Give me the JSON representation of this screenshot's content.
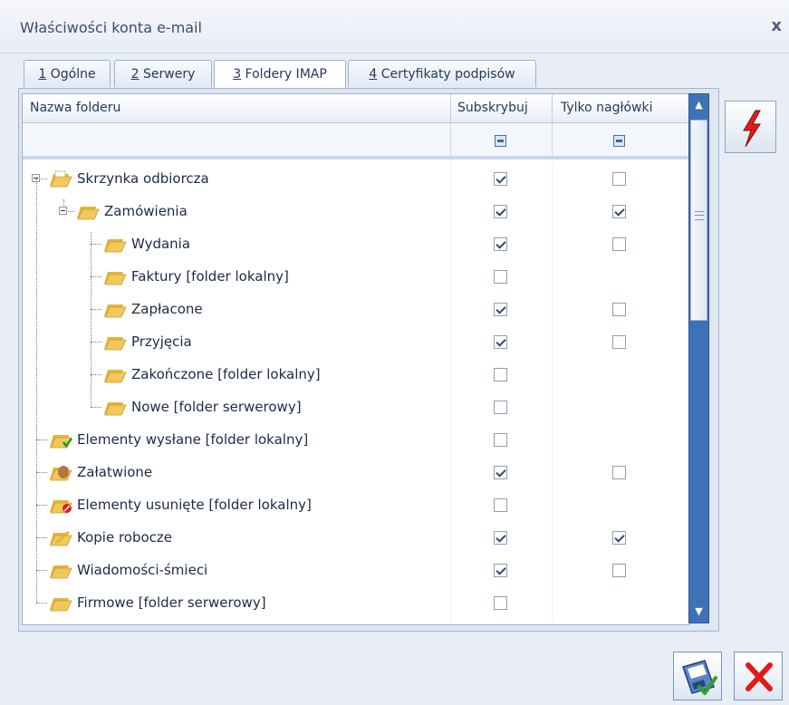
{
  "window": {
    "title": "Właściwości konta e-mail",
    "close_glyph": "x"
  },
  "tabs": [
    {
      "num": "1",
      "label": " Ogólne"
    },
    {
      "num": "2",
      "label": " Serwery"
    },
    {
      "num": "3",
      "label": " Foldery IMAP"
    },
    {
      "num": "4",
      "label": " Certyfikaty podpisów"
    }
  ],
  "active_tab": 2,
  "columns": {
    "name": "Nazwa folderu",
    "subscribe": "Subskrybuj",
    "headers_only": "Tylko nagłówki"
  },
  "rows": [
    {
      "label": "Skrzynka odbiorcza",
      "subscribe": true,
      "headers": false,
      "icon": "folder-inbox-icon"
    },
    {
      "label": "Zamówienia",
      "subscribe": true,
      "headers": true,
      "icon": "folder-icon"
    },
    {
      "label": "Wydania",
      "subscribe": true,
      "headers": false,
      "icon": "folder-icon"
    },
    {
      "label": "Faktury [folder lokalny]",
      "subscribe": false,
      "headers": null,
      "icon": "folder-icon"
    },
    {
      "label": "Zapłacone",
      "subscribe": true,
      "headers": false,
      "icon": "folder-icon"
    },
    {
      "label": "Przyjęcia",
      "subscribe": true,
      "headers": false,
      "icon": "folder-icon"
    },
    {
      "label": "Zakończone [folder lokalny]",
      "subscribe": false,
      "headers": null,
      "icon": "folder-icon"
    },
    {
      "label": "Nowe [folder serwerowy]",
      "subscribe": false,
      "headers": null,
      "icon": "folder-icon"
    },
    {
      "label": "Elementy wysłane [folder lokalny]",
      "subscribe": false,
      "headers": null,
      "icon": "folder-sent-icon"
    },
    {
      "label": "Załatwione",
      "subscribe": true,
      "headers": false,
      "icon": "folder-done-icon"
    },
    {
      "label": "Elementy usunięte [folder lokalny]",
      "subscribe": false,
      "headers": null,
      "icon": "folder-deleted-icon"
    },
    {
      "label": "Kopie robocze",
      "subscribe": true,
      "headers": true,
      "icon": "folder-drafts-icon"
    },
    {
      "label": "Wiadomości-śmieci",
      "subscribe": true,
      "headers": false,
      "icon": "folder-junk-icon"
    },
    {
      "label": "Firmowe [folder serwerowy]",
      "subscribe": false,
      "headers": null,
      "icon": "folder-icon"
    }
  ],
  "colors": {
    "accent": "#3e72b6",
    "folder": "#f0c95a",
    "danger": "#e01b1b"
  }
}
